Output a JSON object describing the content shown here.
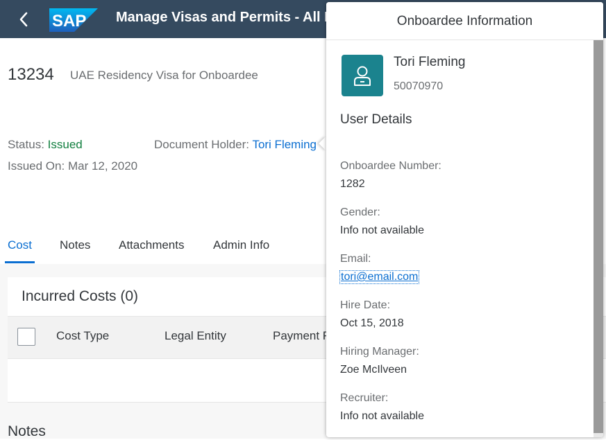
{
  "shell": {
    "title": "Manage Visas and Permits - All Documents",
    "logo_text": "SAP",
    "back_icon": "chevron-left-icon"
  },
  "object": {
    "id": "13234",
    "title": "UAE Residency Visa for Onboardee",
    "status_label": "Status:",
    "status_value": "Issued",
    "holder_label": "Document Holder:",
    "holder_value": "Tori Fleming",
    "issued_label": "Issued On:",
    "issued_value": "Mar 12, 2020"
  },
  "tabs": [
    {
      "label": "Cost",
      "active": true
    },
    {
      "label": "Notes",
      "active": false
    },
    {
      "label": "Attachments",
      "active": false
    },
    {
      "label": "Admin Info",
      "active": false
    }
  ],
  "costs": {
    "title": "Incurred Costs (0)",
    "columns": [
      "Cost Type",
      "Legal Entity",
      "Payment Responsibility"
    ]
  },
  "notes_heading": "Notes",
  "popover": {
    "title": "Onboardee Information",
    "name": "Tori Fleming",
    "user_id": "50070970",
    "section": "User Details",
    "fields": [
      {
        "label": "Onboardee Number:",
        "value": "1282"
      },
      {
        "label": "Gender:",
        "value": "Info not available"
      },
      {
        "label": "Email:",
        "value": "tori@email.com"
      },
      {
        "label": "Hire Date:",
        "value": "Oct 15, 2018"
      },
      {
        "label": "Hiring Manager:",
        "value": "Zoe McIlveen"
      },
      {
        "label": "Recruiter:",
        "value": "Info not available"
      }
    ]
  },
  "colors": {
    "shell": "#354a5f",
    "accent": "#0a6ed1",
    "status_positive": "#107e3e",
    "avatar": "#1b838e"
  }
}
